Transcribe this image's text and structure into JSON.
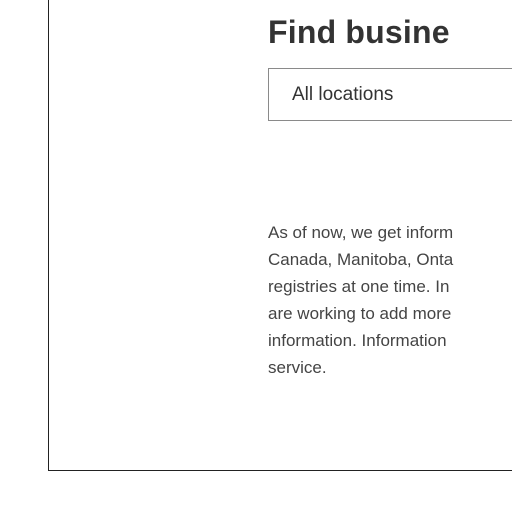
{
  "search": {
    "title": "Find busine",
    "location_select_value": "All locations"
  },
  "info": {
    "lines": [
      "As of now, we get inform",
      "Canada, Manitoba, Onta",
      "registries at one time. In",
      "are working to add more",
      "information. Information",
      "service."
    ]
  },
  "colors": {
    "map_fill": "#dceef1",
    "border": "#222222",
    "title_text": "#333333",
    "body_text": "#444444"
  },
  "icons": {
    "background_map": "canada-map-silhouette"
  }
}
